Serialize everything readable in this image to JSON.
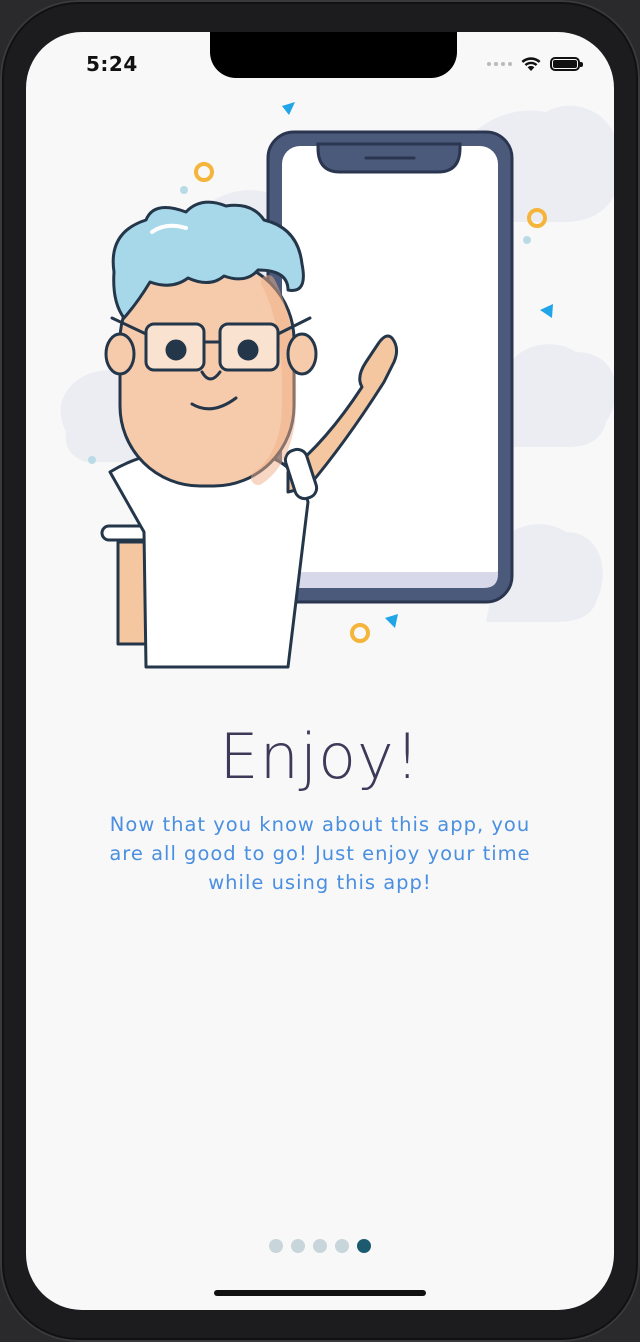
{
  "status_bar": {
    "time": "5:24"
  },
  "onboarding": {
    "title": "Enjoy!",
    "description": "Now that you know about this app, you are all good to go! Just enjoy your time while using this app!",
    "current_page": 5,
    "total_pages": 5
  },
  "icons": {
    "signal": "cellular-signal-icon",
    "wifi": "wifi-icon",
    "battery": "battery-icon"
  },
  "colors": {
    "title": "#3c3a58",
    "description": "#4a8fe0",
    "dot_inactive": "#c8d5da",
    "dot_active": "#1c5a70",
    "background": "#f8f8f9"
  }
}
